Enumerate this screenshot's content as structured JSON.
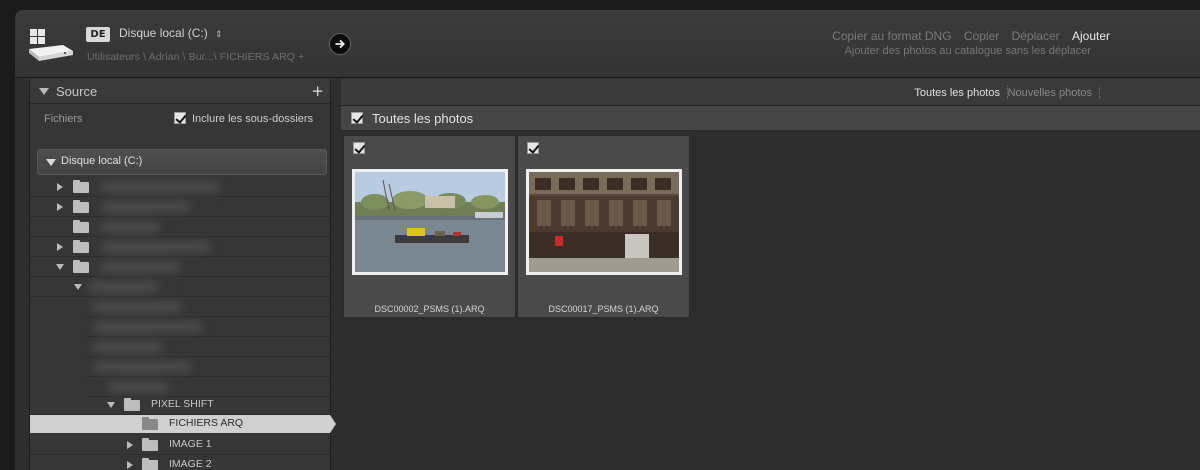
{
  "header": {
    "language_badge": "DE",
    "source_title": "Disque local (C:)",
    "source_updown": "⇕",
    "breadcrumb": "Utilisateurs \\ Adrian \\ Bur...\\ FICHIERS ARQ +",
    "modes": [
      "Copier au format DNG",
      "Copier",
      "Déplacer",
      "Ajouter"
    ],
    "active_mode": "Ajouter",
    "mode_description": "Ajouter des photos au catalogue sans les déplacer",
    "drive_icon": "hard-drive-icon",
    "arrow_icon": "arrow-right-circle-icon"
  },
  "source_panel": {
    "title": "Source",
    "add_icon": "+",
    "files_label": "Fichiers",
    "include_subfolders_label": "Inclure les sous-dossiers",
    "include_subfolders_checked": true,
    "volume": "Disque local (C:)",
    "folders": [
      {
        "name": "PIXEL SHIFT",
        "expanded": true
      },
      {
        "name": "FICHIERS ARQ",
        "selected": true
      },
      {
        "name": "IMAGE 1",
        "expanded": false
      },
      {
        "name": "IMAGE 2",
        "expanded": false
      }
    ]
  },
  "content": {
    "filters": [
      "Toutes les photos",
      "Nouvelles photos"
    ],
    "active_filter": "Toutes les photos",
    "section_title": "Toutes les photos",
    "photos": [
      {
        "filename": "DSC00002_PSMS (1).ARQ",
        "checked": true
      },
      {
        "filename": "DSC00017_PSMS (1).ARQ",
        "checked": true
      }
    ]
  },
  "colors": {
    "panel_bg": "#363636",
    "header_bg": "#333333",
    "selection": "#d0d0d0",
    "text_active": "#e8e8e8",
    "text_dim": "#7a7a7a"
  }
}
